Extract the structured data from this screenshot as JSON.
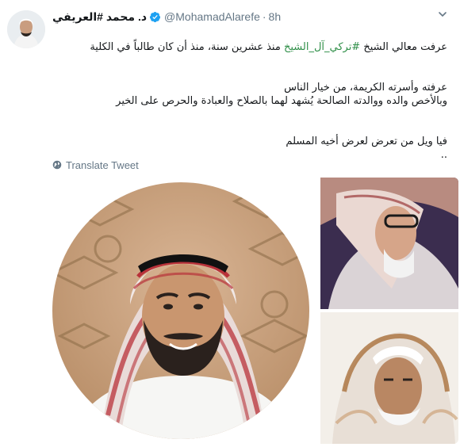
{
  "header": {
    "display_name": "د. محمد #العريفي",
    "handle": "@MohamadAlarefe",
    "separator": "·",
    "time": "8h"
  },
  "body": {
    "line1_before": "عرفت معالي الشيخ ",
    "line1_hashtag": "#تركي_آل_الشيخ",
    "line1_after": " منذ عشرين سنة، منذ أن كان طالباً في الكلية",
    "line2": "عرفته وأسرته الكريمة، من خيار الناس",
    "line3": "وبالأخص والده ووالدته الصالحة يُشهد لهما بالصلاح والعبادة والحرص على الخير",
    "line4": "فيا ويل من تعرض لعرض أخيه المسلم",
    "line5": ".."
  },
  "translate": {
    "label": "Translate Tweet"
  },
  "icons": {
    "verified": "verified-badge-icon",
    "chevron": "chevron-down-icon",
    "globe": "globe-icon"
  },
  "colors": {
    "link": "#1b95e0",
    "muted": "#657786",
    "text": "#14171a"
  }
}
